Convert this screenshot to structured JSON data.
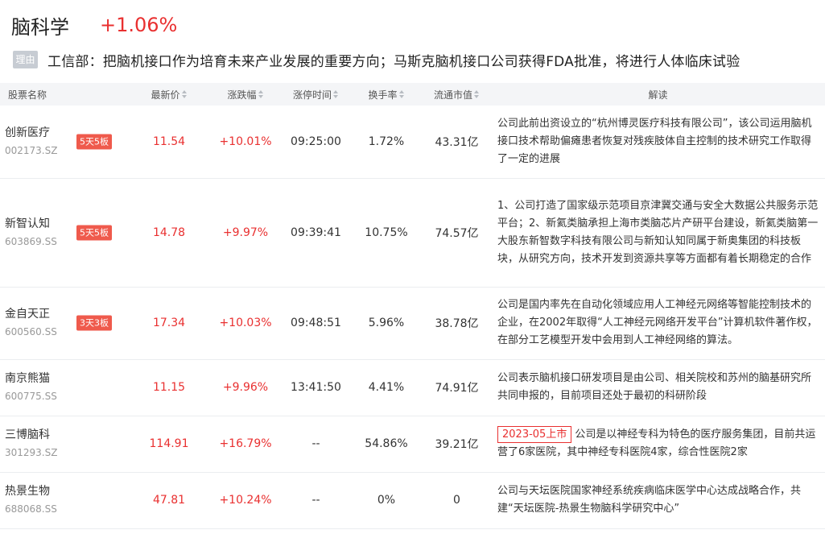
{
  "page": {
    "title": "脑科学",
    "change": "+1.06%"
  },
  "reason": {
    "tag": "理由",
    "text": "工信部：把脑机接口作为培育未来产业发展的重要方向；马斯克脑机接口公司获得FDA批准，将进行人体临床试验"
  },
  "table": {
    "headers": {
      "name": "股票名称",
      "price": "最新价",
      "change": "涨跌幅",
      "limit_time": "涨停时间",
      "turnover": "换手率",
      "market_cap": "流通市值",
      "desc": "解读"
    },
    "rows": [
      {
        "name": "创新医疗",
        "code": "002173.SZ",
        "badge": "5天5板",
        "price": "11.54",
        "change": "+10.01%",
        "time": "09:25:00",
        "turnover": "1.72%",
        "cap": "43.31亿",
        "listing": "",
        "desc": "公司此前出资设立的“杭州博灵医疗科技有限公司”，该公司运用脑机接口技术帮助偏瘫患者恢复对残疾肢体自主控制的技术研究工作取得了一定的进展"
      },
      {
        "name": "新智认知",
        "code": "603869.SS",
        "badge": "5天5板",
        "price": "14.78",
        "change": "+9.97%",
        "time": "09:39:41",
        "turnover": "10.75%",
        "cap": "74.57亿",
        "listing": "",
        "desc": "1、公司打造了国家级示范项目京津冀交通与安全大数据公共服务示范平台；2、新氦类脑承担上海市类脑芯片产研平台建设，新氦类脑第一大股东新智数字科技有限公司与新知认知同属于新奥集团的科技板块，从研究方向，技术开发到资源共享等方面都有着长期稳定的合作"
      },
      {
        "name": "金自天正",
        "code": "600560.SS",
        "badge": "3天3板",
        "price": "17.34",
        "change": "+10.03%",
        "time": "09:48:51",
        "turnover": "5.96%",
        "cap": "38.78亿",
        "listing": "",
        "desc": "公司是国内率先在自动化领域应用人工神经元网络等智能控制技术的企业，在2002年取得“人工神经元网络开发平台”计算机软件著作权，在部分工艺模型开发中会用到人工神经网络的算法。"
      },
      {
        "name": "南京熊猫",
        "code": "600775.SS",
        "badge": "",
        "price": "11.15",
        "change": "+9.96%",
        "time": "13:41:50",
        "turnover": "4.41%",
        "cap": "74.91亿",
        "listing": "",
        "desc": "公司表示脑机接口研发项目是由公司、相关院校和苏州的脑基研究所共同申报的，目前项目还处于最初的科研阶段"
      },
      {
        "name": "三博脑科",
        "code": "301293.SZ",
        "badge": "",
        "price": "114.91",
        "change": "+16.79%",
        "time": "--",
        "turnover": "54.86%",
        "cap": "39.21亿",
        "listing": "2023-05上市",
        "desc": "公司是以神经专科为特色的医疗服务集团，目前共运营了6家医院，其中神经专科医院4家，综合性医院2家"
      },
      {
        "name": "热景生物",
        "code": "688068.SS",
        "badge": "",
        "price": "47.81",
        "change": "+10.24%",
        "time": "--",
        "turnover": "0%",
        "cap": "0",
        "listing": "",
        "desc": "公司与天坛医院国家神经系统疾病临床医学中心达成战略合作，共建“天坛医院-热景生物脑科学研究中心”"
      }
    ]
  }
}
